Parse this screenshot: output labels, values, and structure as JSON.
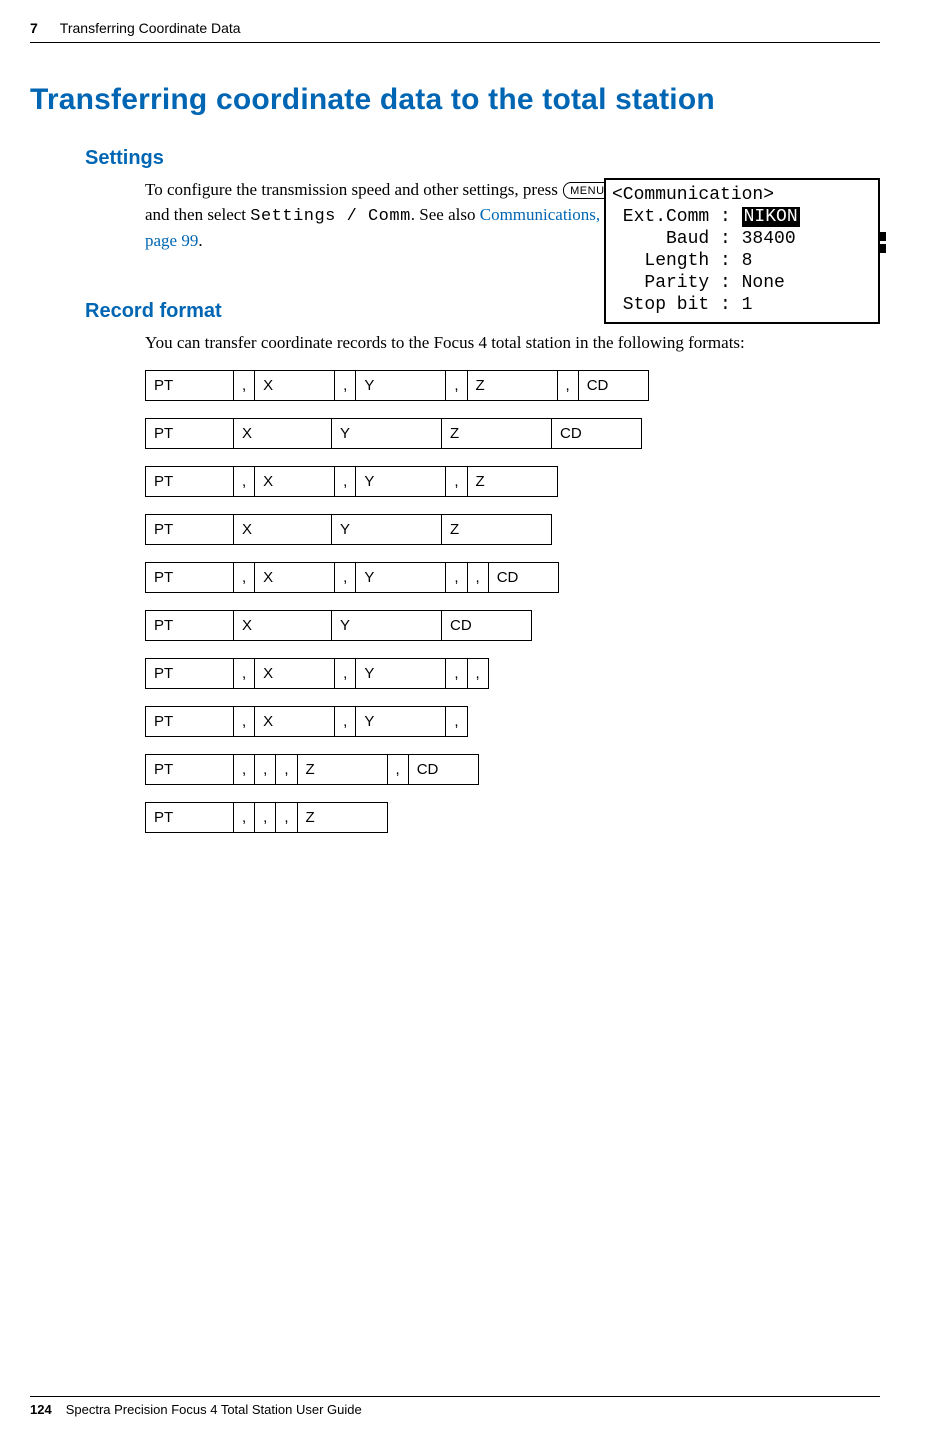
{
  "header": {
    "chapter_number": "7",
    "chapter_title": "Transferring Coordinate Data"
  },
  "section_title": "Transferring coordinate data to the total station",
  "settings": {
    "heading": "Settings",
    "text_before_key": "To configure the transmission speed and other settings, press ",
    "key_label": "MENU",
    "text_mid": " and then select ",
    "mono_path": "Settings / Comm",
    "text_after_mono": ". See also ",
    "link_text": "Communications, page 99",
    "text_end": "."
  },
  "lcd": {
    "title": "<Communication>",
    "rows": [
      {
        "label": "Ext.Comm",
        "value": "NIKON",
        "highlight": true
      },
      {
        "label": "Baud",
        "value": "38400",
        "highlight": false
      },
      {
        "label": "Length",
        "value": "8",
        "highlight": false
      },
      {
        "label": "Parity",
        "value": "None",
        "highlight": false
      },
      {
        "label": "Stop bit",
        "value": "1",
        "highlight": false
      }
    ]
  },
  "record_format": {
    "heading": "Record format",
    "intro": "You can transfer coordinate records to the Focus 4 total station in the following formats:"
  },
  "formats": [
    [
      {
        "t": "PT",
        "c": "pt"
      },
      {
        "t": ",",
        "c": "comma"
      },
      {
        "t": "X",
        "c": "x"
      },
      {
        "t": ",",
        "c": "comma"
      },
      {
        "t": "Y",
        "c": "y"
      },
      {
        "t": ",",
        "c": "comma"
      },
      {
        "t": "Z",
        "c": "z"
      },
      {
        "t": ",",
        "c": "comma"
      },
      {
        "t": "CD",
        "c": "cd"
      }
    ],
    [
      {
        "t": "PT",
        "c": "pt"
      },
      {
        "t": "X",
        "c": "xw"
      },
      {
        "t": "Y",
        "c": "yw"
      },
      {
        "t": "Z",
        "c": "zw"
      },
      {
        "t": "CD",
        "c": "cdw"
      }
    ],
    [
      {
        "t": "PT",
        "c": "pt"
      },
      {
        "t": ",",
        "c": "comma"
      },
      {
        "t": "X",
        "c": "x"
      },
      {
        "t": ",",
        "c": "comma"
      },
      {
        "t": "Y",
        "c": "y"
      },
      {
        "t": ",",
        "c": "comma"
      },
      {
        "t": "Z",
        "c": "z"
      }
    ],
    [
      {
        "t": "PT",
        "c": "pt"
      },
      {
        "t": "X",
        "c": "xw"
      },
      {
        "t": "Y",
        "c": "yw"
      },
      {
        "t": "Z",
        "c": "zw"
      }
    ],
    [
      {
        "t": "PT",
        "c": "pt"
      },
      {
        "t": ",",
        "c": "comma"
      },
      {
        "t": "X",
        "c": "x"
      },
      {
        "t": ",",
        "c": "comma"
      },
      {
        "t": "Y",
        "c": "y"
      },
      {
        "t": ",",
        "c": "comma"
      },
      {
        "t": ",",
        "c": "comma"
      },
      {
        "t": "CD",
        "c": "cd"
      }
    ],
    [
      {
        "t": "PT",
        "c": "pt"
      },
      {
        "t": "X",
        "c": "xw"
      },
      {
        "t": "Y",
        "c": "yw"
      },
      {
        "t": "CD",
        "c": "cdw"
      }
    ],
    [
      {
        "t": "PT",
        "c": "pt"
      },
      {
        "t": ",",
        "c": "comma"
      },
      {
        "t": "X",
        "c": "x"
      },
      {
        "t": ",",
        "c": "comma"
      },
      {
        "t": "Y",
        "c": "y"
      },
      {
        "t": ",",
        "c": "comma"
      },
      {
        "t": ",",
        "c": "comma"
      }
    ],
    [
      {
        "t": "PT",
        "c": "pt"
      },
      {
        "t": ",",
        "c": "comma"
      },
      {
        "t": "X",
        "c": "x"
      },
      {
        "t": ",",
        "c": "comma"
      },
      {
        "t": "Y",
        "c": "y"
      },
      {
        "t": ",",
        "c": "comma"
      }
    ],
    [
      {
        "t": "PT",
        "c": "pt"
      },
      {
        "t": ",",
        "c": "comma"
      },
      {
        "t": ",",
        "c": "comma"
      },
      {
        "t": ",",
        "c": "comma"
      },
      {
        "t": "Z",
        "c": "z"
      },
      {
        "t": ",",
        "c": "comma"
      },
      {
        "t": "CD",
        "c": "cd"
      }
    ],
    [
      {
        "t": "PT",
        "c": "pt"
      },
      {
        "t": ",",
        "c": "comma"
      },
      {
        "t": ",",
        "c": "comma"
      },
      {
        "t": ",",
        "c": "comma"
      },
      {
        "t": "Z",
        "c": "z"
      }
    ]
  ],
  "footer": {
    "page_number": "124",
    "book_title": "Spectra Precision Focus 4 Total Station User Guide"
  }
}
